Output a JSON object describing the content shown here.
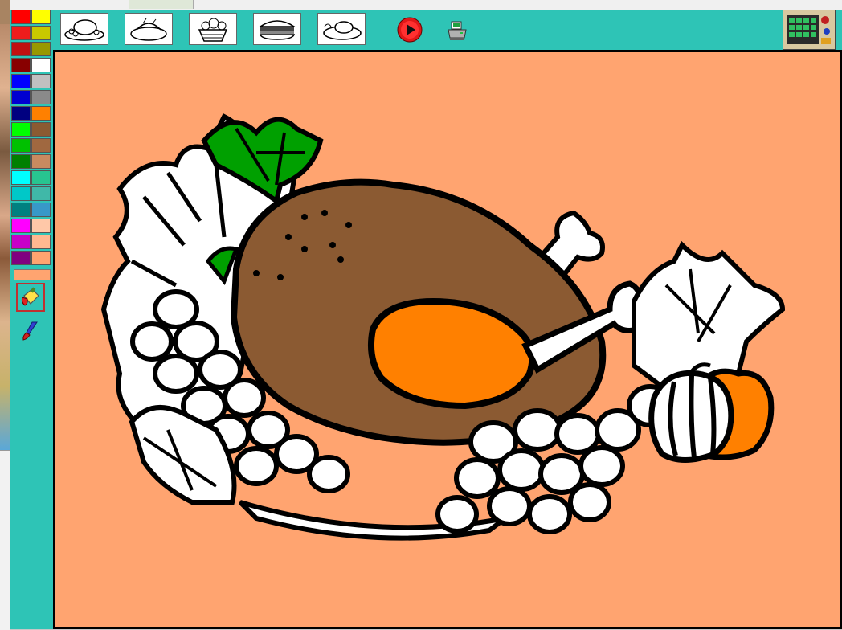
{
  "palette": {
    "colors": [
      "#ff0000",
      "#ffff00",
      "#ee1c1c",
      "#c8c800",
      "#c01010",
      "#989800",
      "#880000",
      "#ffffff",
      "#0000ff",
      "#c0c0c0",
      "#0000d0",
      "#8a8a8a",
      "#000080",
      "#ff8000",
      "#00ff00",
      "#8b5a32",
      "#00c000",
      "#a06840",
      "#008000",
      "#c88a60",
      "#00ffff",
      "#28c490",
      "#00c8c8",
      "#40b8a8",
      "#008080",
      "#3898c8",
      "#ff00ff",
      "#ffc8a8",
      "#c800c8",
      "#ffb890",
      "#800080",
      "#ffa470"
    ],
    "current_color": "#ffa470"
  },
  "tools": {
    "selected": "paint-bucket",
    "items": [
      "paint-bucket",
      "brush"
    ]
  },
  "toolbar": {
    "pictures": [
      "turkey-platter",
      "roast-dish",
      "fruit-basket",
      "sandwich",
      "turkey-plate"
    ],
    "play_icon": "play-icon",
    "print_icon": "printer-icon",
    "palette_editor_icon": "palette-grid-icon"
  },
  "canvas": {
    "picture": "roast-turkey-with-grapes-and-pumpkin",
    "background_fill": "#ffa470",
    "turkey_fill": "#8b5a32",
    "drumstick_fill": "#ff8000",
    "leaf_fill": "#00a000",
    "pumpkin_fill": "#ff8000",
    "outline": "#000000"
  }
}
